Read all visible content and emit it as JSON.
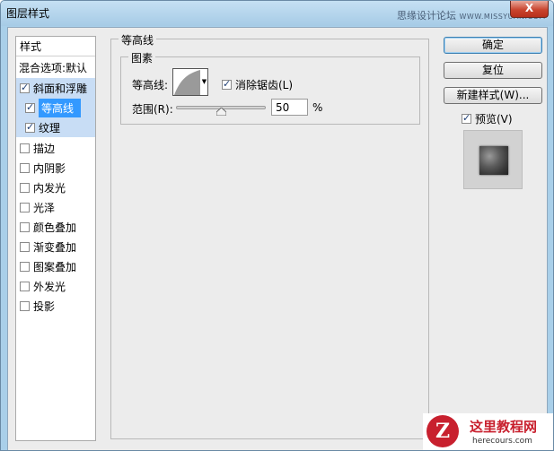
{
  "window": {
    "title": "图层样式",
    "watermark_cn": "思缘设计论坛",
    "watermark_en": "WWW.MISSYUAN.COM",
    "close_label": "X"
  },
  "styles_panel": {
    "header": "样式",
    "blend_options": "混合选项:默认",
    "items": [
      {
        "label": "斜面和浮雕",
        "checked": true
      },
      {
        "label": "等高线",
        "checked": true
      },
      {
        "label": "纹理",
        "checked": true
      },
      {
        "label": "描边",
        "checked": false
      },
      {
        "label": "内阴影",
        "checked": false
      },
      {
        "label": "内发光",
        "checked": false
      },
      {
        "label": "光泽",
        "checked": false
      },
      {
        "label": "颜色叠加",
        "checked": false
      },
      {
        "label": "渐变叠加",
        "checked": false
      },
      {
        "label": "图案叠加",
        "checked": false
      },
      {
        "label": "外发光",
        "checked": false
      },
      {
        "label": "投影",
        "checked": false
      }
    ]
  },
  "contour_section": {
    "group_title": "等高线",
    "elements_title": "图素",
    "contour_label": "等高线:",
    "antialias_label": "消除锯齿(L)",
    "antialias_checked": true,
    "range_label": "范围(R):",
    "range_value": "50",
    "range_unit": "%"
  },
  "buttons": {
    "ok": "确定",
    "reset": "复位",
    "new_style": "新建样式(W)..."
  },
  "preview": {
    "label": "预览(V)",
    "checked": true
  },
  "bottom_watermark": {
    "cn": "这里教程网",
    "en": "herecours.com",
    "logo": "Z"
  },
  "colors": {
    "selection": "#3399ff",
    "selection_light": "#c8ddf5",
    "titlebar": "#a9cfe9"
  }
}
